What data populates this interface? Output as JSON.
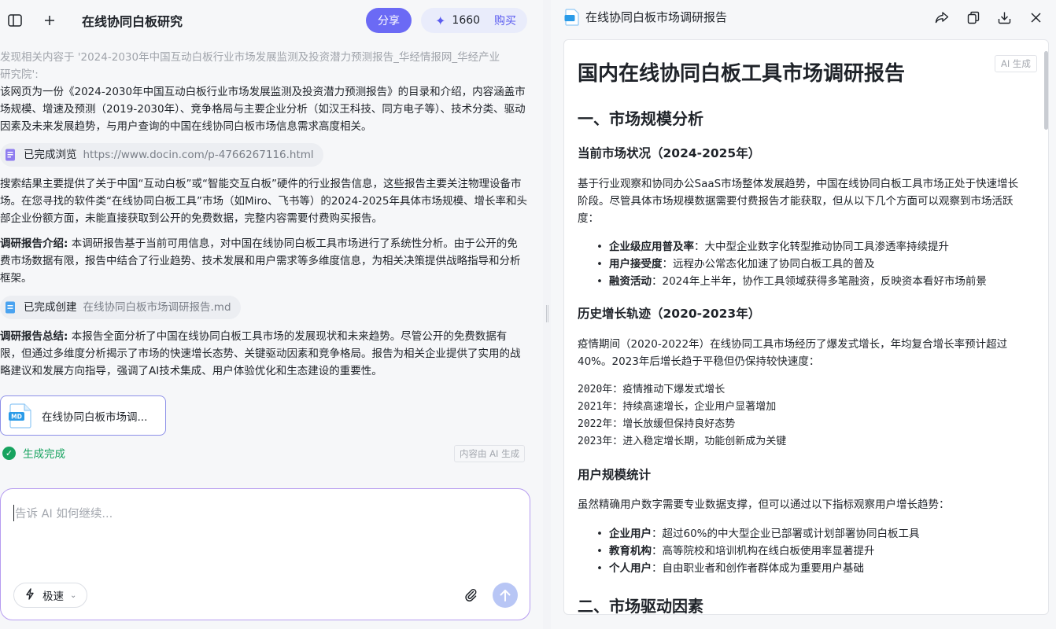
{
  "left": {
    "title": "在线协同白板研究",
    "share_label": "分享",
    "credits": "1660",
    "buy_label": "购买",
    "faded_line1": "发现相关内容于 '2024-2030年中国互动白板行业市场发展监测及投资潜力预测报告_华经情报网_华经产业",
    "faded_line2": "研究院':",
    "para1": "该网页为一份《2024-2030年中国互动白板行业市场发展监测及投资潜力预测报告》的目录和介绍，内容涵盖市场规模、增速及预测（2019-2030年）、竞争格局与主要企业分析（如汉王科技、同方电子等）、技术分类、驱动因素及未来发展趋势，与用户查询的中国在线协同白板市场信息需求高度相关。",
    "browse_chip": {
      "label": "已完成浏览",
      "value": "https://www.docin.com/p-4766267116.html"
    },
    "para2": "搜索结果主要提供了关于中国“互动白板”或“智能交互白板”硬件的行业报告信息，这些报告主要关注物理设备市场。在您寻找的软件类“在线协同白板工具”市场（如Miro、飞书等）的2024-2025年具体市场规模、增长率和头部企业份额方面，未能直接获取到公开的免费数据，完整内容需要付费购买报告。",
    "intro_label": "调研报告介绍:",
    "intro_text": " 本调研报告基于当前可用信息，对中国在线协同白板工具市场进行了系统性分析。由于公开的免费市场数据有限，报告中结合了行业趋势、技术发展和用户需求等多维度信息，为相关决策提供战略指导和分析框架。",
    "create_chip": {
      "label": "已完成创建",
      "value": "在线协同白板市场调研报告.md"
    },
    "summary_label": "调研报告总结:",
    "summary_text": " 本报告全面分析了中国在线协同白板工具市场的发展现状和未来趋势。尽管公开的免费数据有限，但通过多维度分析揭示了市场的快速增长态势、关键驱动因素和竞争格局。报告为相关企业提供了实用的战略建议和发展方向指导，强调了AI技术集成、用户体验优化和生态建设的重要性。",
    "file_card_name": "在线协同白板市场调...",
    "file_badge": "MD",
    "done_label": "生成完成",
    "ai_tag": "内容由 AI 生成",
    "composer_placeholder": "告诉 AI 如何继续...",
    "mode_label": "极速"
  },
  "right": {
    "header_title": "在线协同白板市场调研报告",
    "ai_tag": "AI 生成",
    "doc": {
      "h1": "国内在线协同白板工具市场调研报告",
      "sec1": "一、市场规模分析",
      "sub1": "当前市场状况（2024-2025年）",
      "p1": "基于行业观察和协同办公SaaS市场整体发展趋势，中国在线协同白板工具市场正处于快速增长阶段。尽管具体市场规模数据需要付费报告才能获取，但从以下几个方面可以观察到市场活跃度：",
      "list1": [
        {
          "k": "企业级应用普及率",
          "v": "：大中型企业数字化转型推动协同工具渗透率持续提升"
        },
        {
          "k": "用户接受度",
          "v": "：远程办公常态化加速了协同白板工具的普及"
        },
        {
          "k": "融资活动",
          "v": "：2024年上半年，协作工具领域获得多笔融资，反映资本看好市场前景"
        }
      ],
      "sub2": "历史增长轨迹（2020-2023年）",
      "p2": "疫情期间（2020-2022年）在线协同工具市场经历了爆发式增长，年均复合增长率预计超过40%。2023年后增长趋于平稳但仍保持较快速度：",
      "years": [
        "2020年：疫情推动下爆发式增长",
        "2021年：持续高速增长，企业用户显著增加",
        "2022年：增长放缓但保持良好态势",
        "2023年：进入稳定增长期，功能创新成为关键"
      ],
      "sub3": "用户规模统计",
      "p3": "虽然精确用户数字需要专业数据支撑，但可以通过以下指标观察用户增长趋势：",
      "list2": [
        {
          "k": "企业用户",
          "v": "：超过60%的中大型企业已部署或计划部署协同白板工具"
        },
        {
          "k": "教育机构",
          "v": "：高等院校和培训机构在线白板使用率显著提升"
        },
        {
          "k": "个人用户",
          "v": "：自由职业者和创作者群体成为重要用户基础"
        }
      ],
      "sec2": "二、市场驱动因素"
    }
  }
}
